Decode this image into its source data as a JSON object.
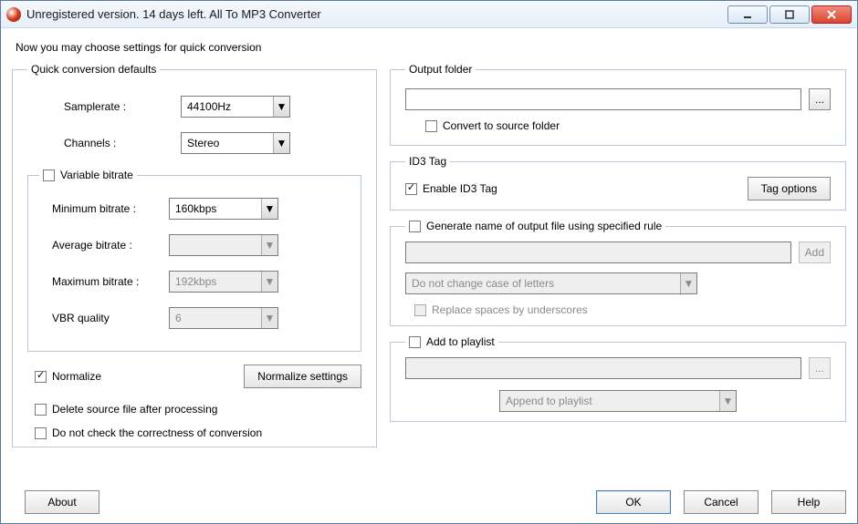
{
  "title": "Unregistered version. 14 days left. All To MP3 Converter",
  "intro": "Now you may choose settings for quick conversion",
  "left": {
    "group_title": "Quick conversion defaults",
    "samplerate_label": "Samplerate :",
    "samplerate_value": "44100Hz",
    "channels_label": "Channels :",
    "channels_value": "Stereo",
    "vb_legend": "Variable bitrate",
    "min_bitrate_label": "Minimum bitrate :",
    "min_bitrate_value": "160kbps",
    "avg_bitrate_label": "Average bitrate :",
    "avg_bitrate_value": "",
    "max_bitrate_label": "Maximum bitrate :",
    "max_bitrate_value": "192kbps",
    "vbr_quality_label": "VBR quality",
    "vbr_quality_value": "6",
    "normalize_label": "Normalize",
    "normalize_settings_btn": "Normalize settings",
    "delete_source_label": "Delete source file after processing",
    "no_check_label": "Do not check the correctness of conversion"
  },
  "right": {
    "output_legend": "Output folder",
    "output_value": "",
    "browse_label": "...",
    "convert_source_label": "Convert to source folder",
    "id3_legend": "ID3 Tag",
    "enable_id3_label": "Enable ID3 Tag",
    "tag_options_btn": "Tag options",
    "gen_legend": "Generate name of output file using specified rule",
    "gen_input": "",
    "gen_add_btn": "Add",
    "gen_case_value": "Do not change case of letters",
    "gen_replace_label": "Replace spaces by underscores",
    "playlist_legend": "Add to playlist",
    "playlist_input": "",
    "playlist_browse": "...",
    "playlist_mode": "Append to playlist"
  },
  "buttons": {
    "about": "About",
    "ok": "OK",
    "cancel": "Cancel",
    "help": "Help"
  }
}
